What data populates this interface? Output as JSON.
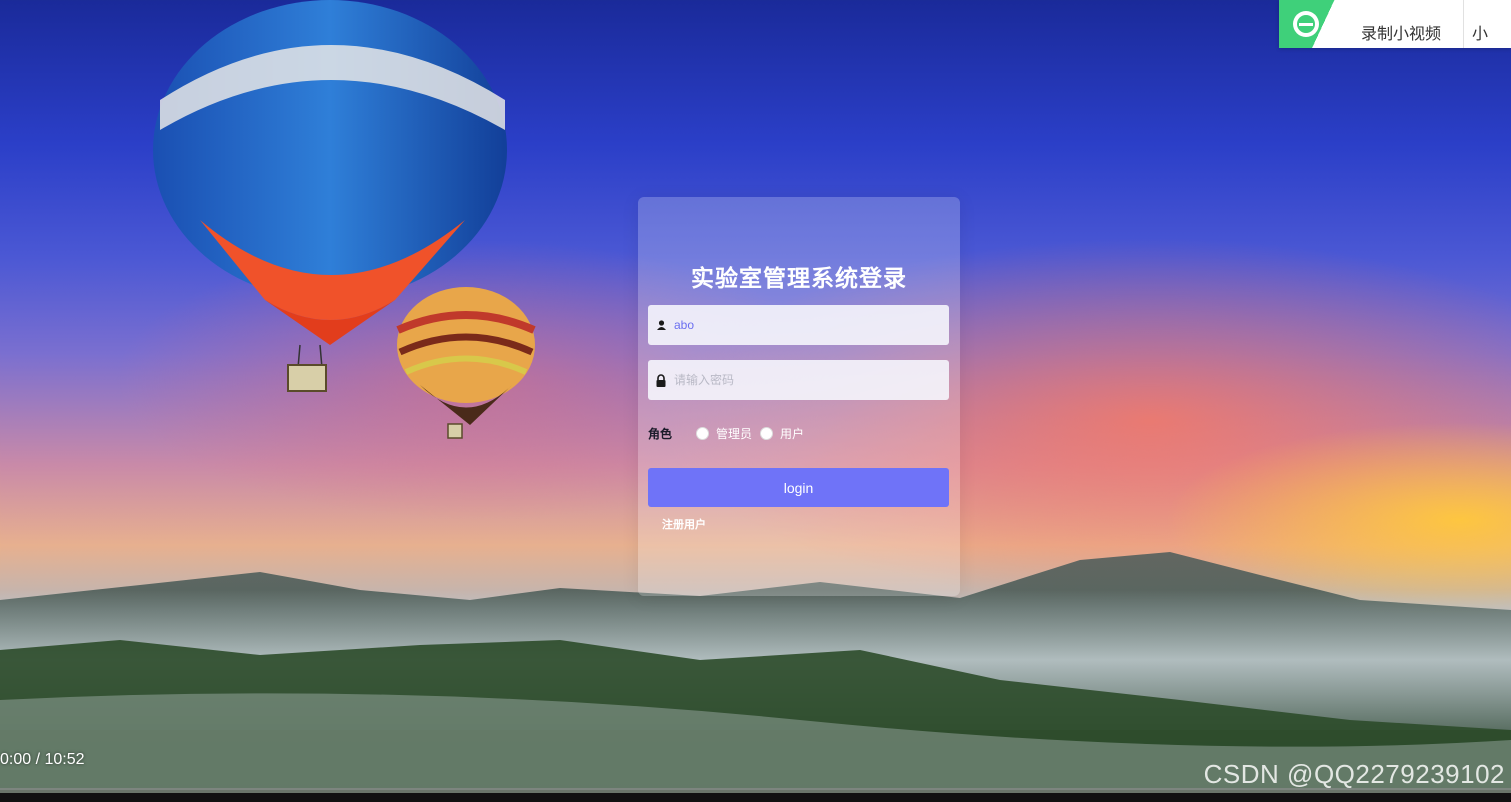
{
  "login": {
    "title": "实验室管理系统登录",
    "username": {
      "value": "abo",
      "icon": "user-icon"
    },
    "password": {
      "placeholder": "请输入密码",
      "icon": "lock-icon"
    },
    "role": {
      "label": "角色",
      "options": [
        "管理员",
        "用户"
      ],
      "selected": null
    },
    "submit_label": "login",
    "register_link": "注册用户"
  },
  "widget": {
    "record_label": "录制小视频",
    "more_label": "小"
  },
  "player": {
    "time": "0:00 / 10:52"
  },
  "watermark": "CSDN @QQ2279239102",
  "colors": {
    "accent": "#6f73f8",
    "widget_green": "#3fd07a"
  }
}
